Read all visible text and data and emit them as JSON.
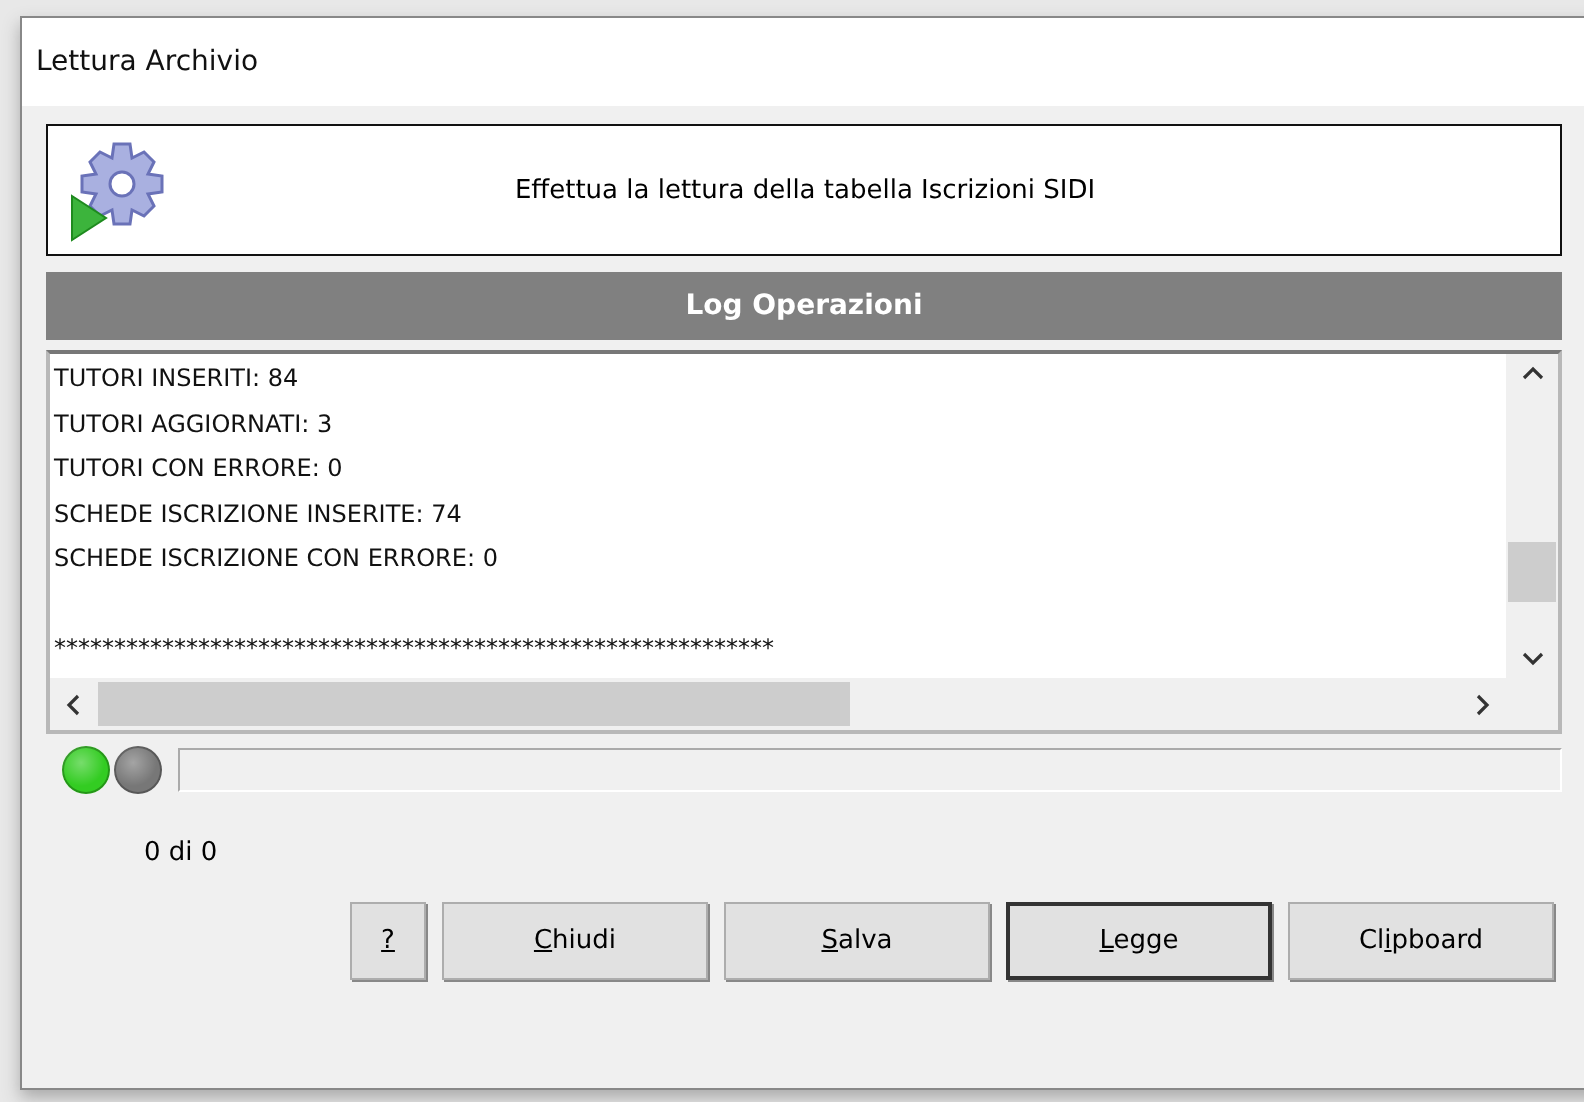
{
  "window": {
    "title": "Lettura Archivio"
  },
  "header": {
    "text": "Effettua la lettura della tabella Iscrizioni SIDI"
  },
  "log": {
    "title": "Log Operazioni",
    "lines": [
      "TUTORI INSERITI: 84",
      "TUTORI AGGIORNATI: 3",
      "TUTORI CON ERRORE: 0",
      "SCHEDE ISCRIZIONE INSERITE: 74",
      "SCHEDE ISCRIZIONE CON ERRORE: 0"
    ],
    "separator": "************************************************************"
  },
  "lights": [
    {
      "color": "#33cc22"
    },
    {
      "color": "#777777"
    }
  ],
  "progress": {
    "level": 0,
    "counter": "0 di 0"
  },
  "buttons": [
    {
      "access_key": "?",
      "default": false
    },
    {
      "access_key": "C",
      "after": "hiudi",
      "default": false
    },
    {
      "access_key": "S",
      "after": "alva",
      "default": false
    },
    {
      "access_key": "L",
      "after": "egge",
      "default": true
    },
    {
      "before": "Cl",
      "access_key": "i",
      "after": "pboard",
      "default": false
    }
  ]
}
